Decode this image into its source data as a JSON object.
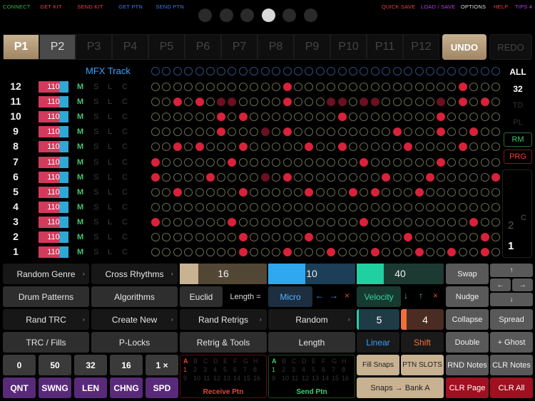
{
  "toplinks": [
    {
      "label": "CONNECT",
      "color": "#3ab34a"
    },
    {
      "label": "GET KIT",
      "color": "#e8433c"
    },
    {
      "label": "SEND KIT",
      "color": "#e8433c"
    },
    {
      "label": "GET PTN",
      "color": "#3a7de8"
    },
    {
      "label": "SEND PTN",
      "color": "#3a7de8"
    }
  ],
  "toprightlinks": [
    {
      "label": "QUICK SAVE",
      "color": "#e8433c"
    },
    {
      "label": "LOAD / SAVE",
      "color": "#c43ae8"
    },
    {
      "label": "OPTIONS",
      "color": "#dddddd"
    },
    {
      "label": "HELP",
      "color": "#e8433c"
    },
    {
      "label": "TIPS 4",
      "color": "#c43ae8"
    }
  ],
  "pages": {
    "count": 6,
    "active": 3
  },
  "patterns": [
    "P1",
    "P2",
    "P3",
    "P4",
    "P5",
    "P6",
    "P7",
    "P8",
    "P9",
    "P10",
    "P11",
    "P12"
  ],
  "undo": "UNDO",
  "redo": "REDO",
  "mfx_label": "MFX Track",
  "tracks": [
    {
      "num": "12",
      "vel": "110",
      "steps": "............1...............1.."
    },
    {
      "num": "11",
      "vel": "110",
      "steps": "..1.1.dd....1...dd.dd.....d.1.1."
    },
    {
      "num": "10",
      "vel": "110",
      "steps": "......1.1........1........1....."
    },
    {
      "num": "9",
      "vel": "110",
      "steps": "......1...d.1.........1...1..1..1"
    },
    {
      "num": "8",
      "vel": "110",
      "steps": "..1.1...1.....1..1.....1....1..."
    },
    {
      "num": "7",
      "vel": "110",
      "steps": "1......1...........1......1....."
    },
    {
      "num": "6",
      "vel": "110",
      "steps": "1....1....d.1........1...1.....1."
    },
    {
      "num": "5",
      "vel": "110",
      "steps": "..1.....1.....1...1.1...1.......1"
    },
    {
      "num": "4",
      "vel": "110",
      "steps": "................................."
    },
    {
      "num": "3",
      "vel": "110",
      "steps": "1......1...........1.........1.."
    },
    {
      "num": "2",
      "vel": "110",
      "steps": "........1.....1........1......1.1"
    },
    {
      "num": "1",
      "vel": "110",
      "steps": "........1...1...1...1...1..1..1."
    }
  ],
  "msl": {
    "m": "M",
    "s": "S",
    "l": "L",
    "c": "C"
  },
  "right_side": {
    "all": "ALL",
    "steps": "32",
    "td": "TD",
    "pl": "PL",
    "rm": "RM",
    "prg": "PRG",
    "small2": "2",
    "small1": "1",
    "c": "C"
  },
  "left_buttons": [
    [
      "Random Genre",
      "Cross Rhythms"
    ],
    [
      "Drum Patterns",
      "Algorithms"
    ],
    [
      "Rand TRC",
      "Create New"
    ],
    [
      "TRC / Fills",
      "P-Locks"
    ]
  ],
  "mid_buttons": {
    "slider1": "16",
    "slider2": "10",
    "slider3": "40",
    "euclid": "Euclid",
    "length_eq": "Length =",
    "micro": "Micro",
    "velocity": "Velocity",
    "rand_retrigs": "Rand Retrigs",
    "random": "Random",
    "retrig_tools": "Retrig & Tools",
    "length": "Length",
    "stepper5": "5",
    "stepper4": "4",
    "linear": "Linear",
    "shift": "Shift"
  },
  "right_buttons": {
    "swap": "Swap",
    "nudge": "Nudge",
    "collapse": "Collapse",
    "spread": "Spread",
    "double": "Double",
    "ghost": "+ Ghost",
    "rnd_notes": "RND Notes",
    "clr_notes": "CLR Notes",
    "clr_page": "CLR Page",
    "clr_all": "CLR All",
    "fill_snaps": "Fill Snaps",
    "ptn_slots": "PTN SLOTS",
    "snaps_bank": "Snaps → Bank A"
  },
  "bottom_nums": [
    "0",
    "50",
    "32",
    "16",
    "1 ×"
  ],
  "bottom_labels": [
    "QNT",
    "SWNG",
    "LEN",
    "CHNG",
    "SPD"
  ],
  "receive_ptn": "Receive Ptn",
  "send_ptn": "Send Ptn",
  "banks": [
    "A",
    "B",
    "C",
    "D",
    "E",
    "F",
    "G",
    "H"
  ]
}
